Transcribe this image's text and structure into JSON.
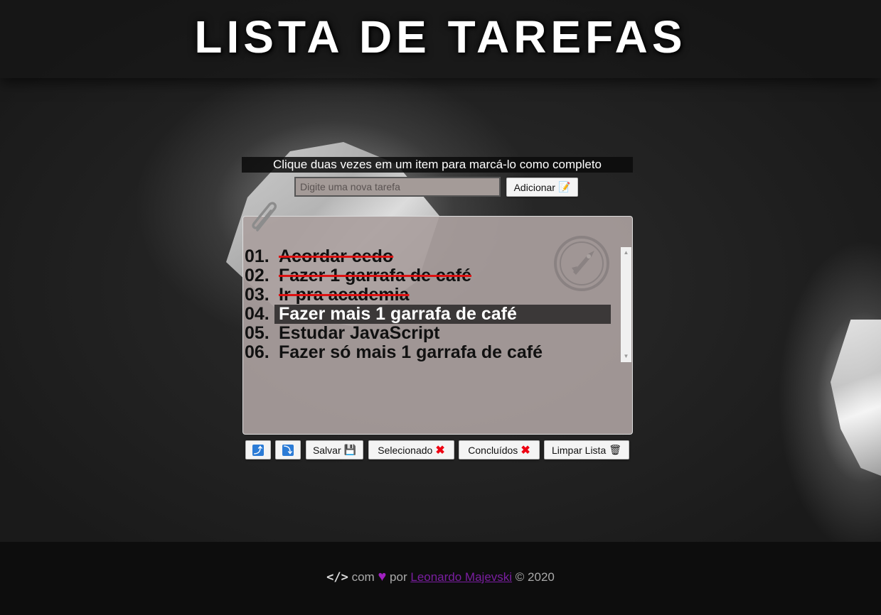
{
  "header": {
    "title": "LISTA DE TAREFAS"
  },
  "instruction": "Clique duas vezes em um item para marcá-lo como completo",
  "new_task": {
    "placeholder": "Digite uma nova tarefa",
    "value": ""
  },
  "add_button": {
    "label": "Adicionar",
    "icon": "memo-icon",
    "glyph": "📝"
  },
  "tasks": [
    {
      "number": "01.",
      "text": "Acordar cedo",
      "status": "completed"
    },
    {
      "number": "02.",
      "text": "Fazer 1 garrafa de café",
      "status": "completed"
    },
    {
      "number": "03.",
      "text": "Ir pra academia",
      "status": "completed"
    },
    {
      "number": "04.",
      "text": "Fazer mais 1 garrafa de café",
      "status": "selected"
    },
    {
      "number": "05.",
      "text": "Estudar JavaScript",
      "status": "pending"
    },
    {
      "number": "06.",
      "text": "Fazer só mais 1 garrafa de café",
      "status": "pending"
    }
  ],
  "toolbar": {
    "move_up": {
      "icon": "arrow-up-icon",
      "glyph": "⤴"
    },
    "move_down": {
      "icon": "arrow-down-icon",
      "glyph": "⤵"
    },
    "save": {
      "label": "Salvar",
      "icon": "floppy-disk-icon",
      "glyph": "💾"
    },
    "remove_selected": {
      "label": "Selecionado",
      "icon": "cross-mark-icon",
      "glyph": "✖"
    },
    "remove_completed": {
      "label": "Concluídos",
      "icon": "cross-mark-icon",
      "glyph": "✖"
    },
    "clear_list": {
      "label": "Limpar Lista",
      "icon": "trash-icon",
      "glyph": "🗑"
    }
  },
  "footer": {
    "code_glyph": "</>",
    "with_text": "com",
    "heart_glyph": "♥",
    "by_text": "por",
    "author": "Leonardo Majevski",
    "copyright": "© 2020"
  },
  "colors": {
    "completed_strike": "#dd1111",
    "selected_bg": "#3b3838",
    "author_link": "#7a1ea0",
    "heart": "#a020c0"
  }
}
